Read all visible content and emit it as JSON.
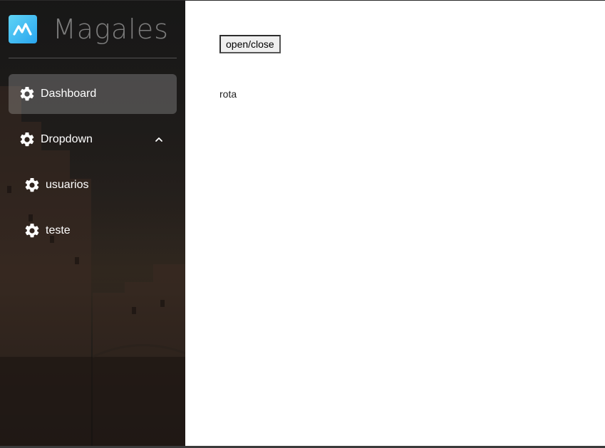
{
  "brand": {
    "name": "Magales",
    "logo_icon": "wave-logo-icon",
    "logo_color": "#3ab7f2"
  },
  "sidebar": {
    "items": [
      {
        "label": "Dashboard",
        "icon": "gear-icon",
        "active": true
      },
      {
        "label": "Dropdown",
        "icon": "gear-icon",
        "expanded": true,
        "chevron": "chevron-up-icon"
      },
      {
        "label": "usuarios",
        "icon": "gear-icon",
        "child": true
      },
      {
        "label": "teste",
        "icon": "gear-icon",
        "child": true
      }
    ]
  },
  "main": {
    "toggle_label": "open/close",
    "route_text": "rota"
  },
  "colors": {
    "sidebar_text": "#ffffff",
    "active_bg": "rgba(200,200,200,0.28)",
    "main_bg": "#ffffff"
  }
}
